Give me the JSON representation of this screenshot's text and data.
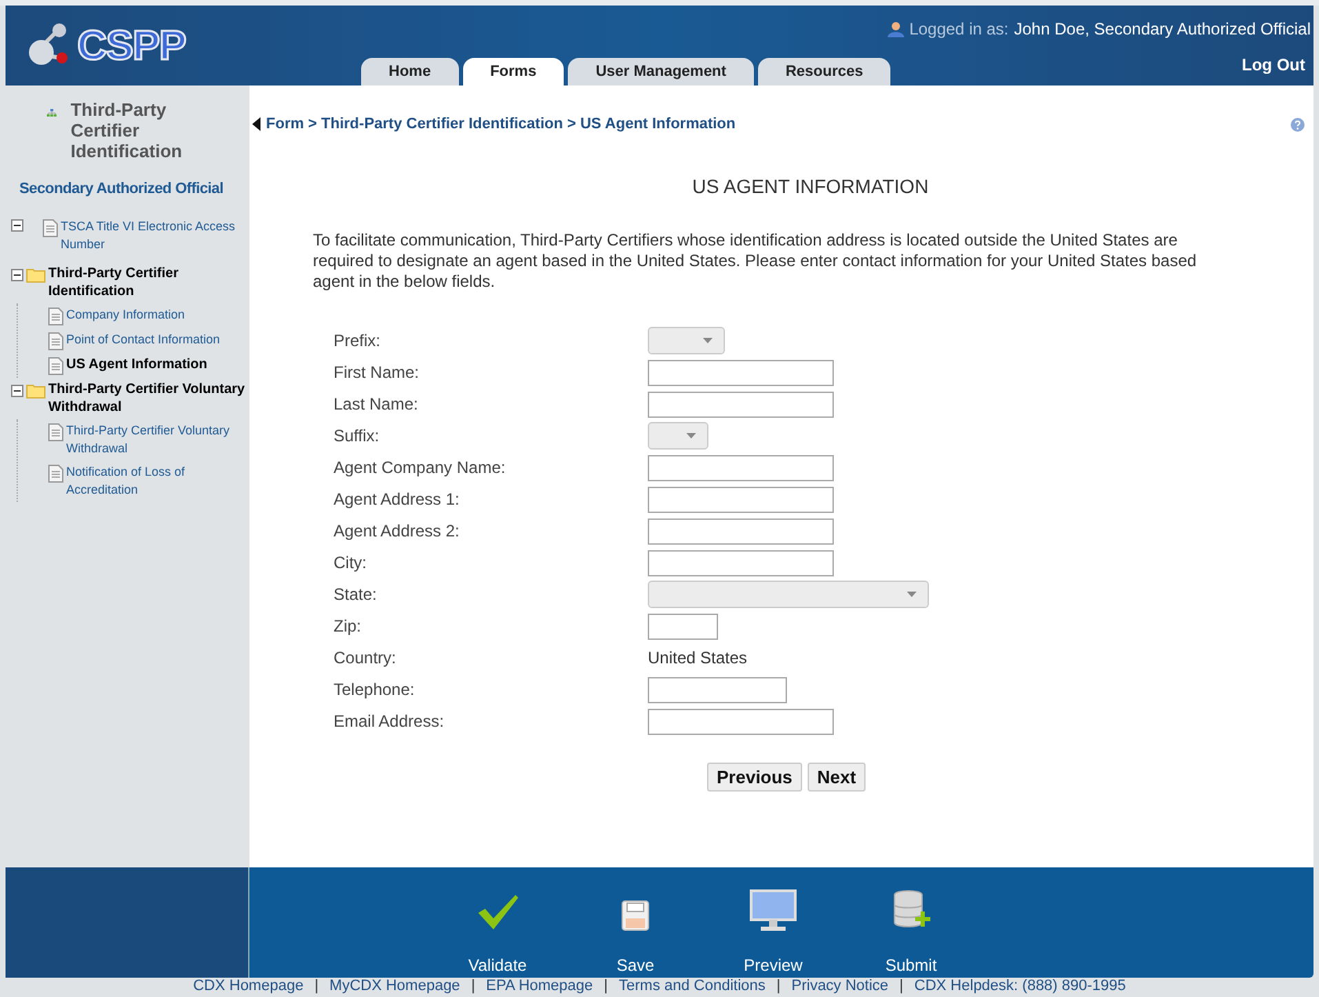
{
  "header": {
    "logo": "CSPP",
    "user_label": "Logged in as:",
    "user_name": "John Doe, Secondary Authorized Official",
    "logout": "Log Out",
    "tabs": [
      {
        "label": "Home",
        "selected": false
      },
      {
        "label": "Forms",
        "selected": true
      },
      {
        "label": "User Management",
        "selected": false
      },
      {
        "label": "Resources",
        "selected": false
      }
    ]
  },
  "sidebar": {
    "title": "Third-Party Certifier Identification",
    "role": "Secondary Authorized Official",
    "tree": [
      {
        "kind": "page",
        "label": "TSCA Title VI Electronic Access Number",
        "selected": false
      },
      {
        "kind": "folder",
        "label": "Third-Party Certifier Identification",
        "expanded": true,
        "children": [
          {
            "kind": "page",
            "label": "Company Information",
            "selected": false
          },
          {
            "kind": "page",
            "label": "Point of Contact Information",
            "selected": false
          },
          {
            "kind": "page",
            "label": "US Agent Information",
            "selected": true
          }
        ]
      },
      {
        "kind": "folder",
        "label": "Third-Party Certifier Voluntary Withdrawal",
        "expanded": true,
        "children": [
          {
            "kind": "page",
            "label": "Third-Party Certifier Voluntary Withdrawal",
            "selected": false
          },
          {
            "kind": "page",
            "label": "Notification of Loss of Accreditation",
            "selected": false
          }
        ]
      }
    ]
  },
  "breadcrumb": "Form > Third-Party Certifier Identification > US Agent Information",
  "heading": "US AGENT INFORMATION",
  "intro": "To facilitate communication, Third-Party Certifiers whose identification address is located outside the United States are required to designate an agent based in the United States. Please enter contact information for your United States based agent in the below fields.",
  "fields": [
    {
      "label": "Prefix:",
      "kind": "select"
    },
    {
      "label": "First Name:",
      "kind": "text"
    },
    {
      "label": "Last Name:",
      "kind": "text"
    },
    {
      "label": "Suffix:",
      "kind": "select-short"
    },
    {
      "label": "Agent Company Name:",
      "kind": "text"
    },
    {
      "label": "Agent Address 1:",
      "kind": "text"
    },
    {
      "label": "Agent Address 2:",
      "kind": "text"
    },
    {
      "label": "City:",
      "kind": "text"
    },
    {
      "label": "State:",
      "kind": "select-wide"
    },
    {
      "label": "Zip:",
      "kind": "text-short"
    },
    {
      "label": "Country:",
      "kind": "static",
      "value": "United States"
    },
    {
      "label": "Telephone:",
      "kind": "text-medium"
    },
    {
      "label": "Email Address:",
      "kind": "text"
    }
  ],
  "buttons": [
    "Previous",
    "Next"
  ],
  "toolbar": [
    {
      "kind": "validate",
      "label": "Validate"
    },
    {
      "kind": "save",
      "label": "Save"
    },
    {
      "kind": "preview",
      "label": "Preview"
    },
    {
      "kind": "submit",
      "label": "Submit"
    }
  ],
  "footer_separator": "|",
  "footer_links": [
    "CDX Homepage",
    "MyCDX Homepage",
    "EPA Homepage",
    "Terms and Conditions",
    "Privacy Notice",
    "CDX Helpdesk: (888) 890-1995"
  ]
}
